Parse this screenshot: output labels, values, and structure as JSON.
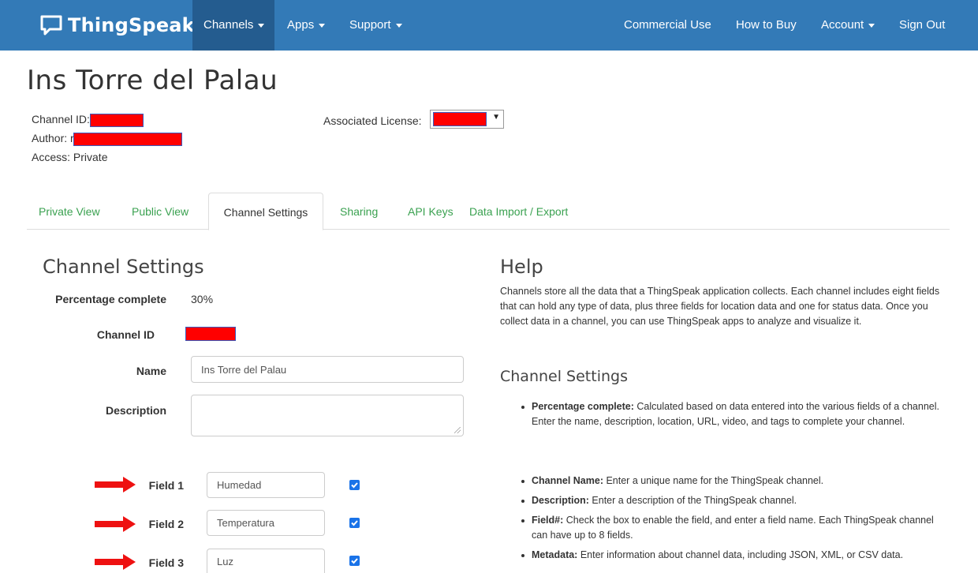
{
  "navbar": {
    "brand": "ThingSpeak",
    "trademark": "™",
    "left_items": [
      "Channels",
      "Apps",
      "Support"
    ],
    "right_items": [
      "Commercial Use",
      "How to Buy",
      "Account",
      "Sign Out"
    ],
    "bg_color": "#337ab7"
  },
  "channel": {
    "title": "Ins Torre del Palau",
    "id_label": "Channel ID:",
    "author_label": "Author: r",
    "access": "Access: Private",
    "license_label": "Associated License:"
  },
  "tabs": [
    "Private View",
    "Public View",
    "Channel Settings",
    "Sharing",
    "API Keys",
    "Data Import / Export"
  ],
  "settings": {
    "title": "Channel Settings",
    "percentage_label": "Percentage complete",
    "percentage_value": "30%",
    "channel_id_label": "Channel ID",
    "name_label": "Name",
    "name_value": "Ins Torre del Palau",
    "description_label": "Description",
    "fields": [
      {
        "label": "Field 1",
        "value": "Humedad",
        "checked": true
      },
      {
        "label": "Field 2",
        "value": "Temperatura",
        "checked": true
      },
      {
        "label": "Field 3",
        "value": "Luz",
        "checked": true
      }
    ]
  },
  "help": {
    "title": "Help",
    "intro": "Channels store all the data that a ThingSpeak application collects. Each channel includes eight fields that can hold any type of data, plus three fields for location data and one for status data. Once you collect data in a channel, you can use ThingSpeak apps to analyze and visualize it.",
    "subtitle": "Channel Settings",
    "items": [
      {
        "term": "Percentage complete:",
        "text": " Calculated based on data entered into the various fields of a channel. Enter the name, description, location, URL, video, and tags to complete your channel."
      },
      {
        "term": "Channel Name:",
        "text": " Enter a unique name for the ThingSpeak channel."
      },
      {
        "term": "Description:",
        "text": " Enter a description of the ThingSpeak channel."
      },
      {
        "term": "Field#:",
        "text": " Check the box to enable the field, and enter a field name. Each ThingSpeak channel can have up to 8 fields."
      },
      {
        "term": "Metadata:",
        "text": " Enter information about channel data, including JSON, XML, or CSV data."
      }
    ]
  }
}
